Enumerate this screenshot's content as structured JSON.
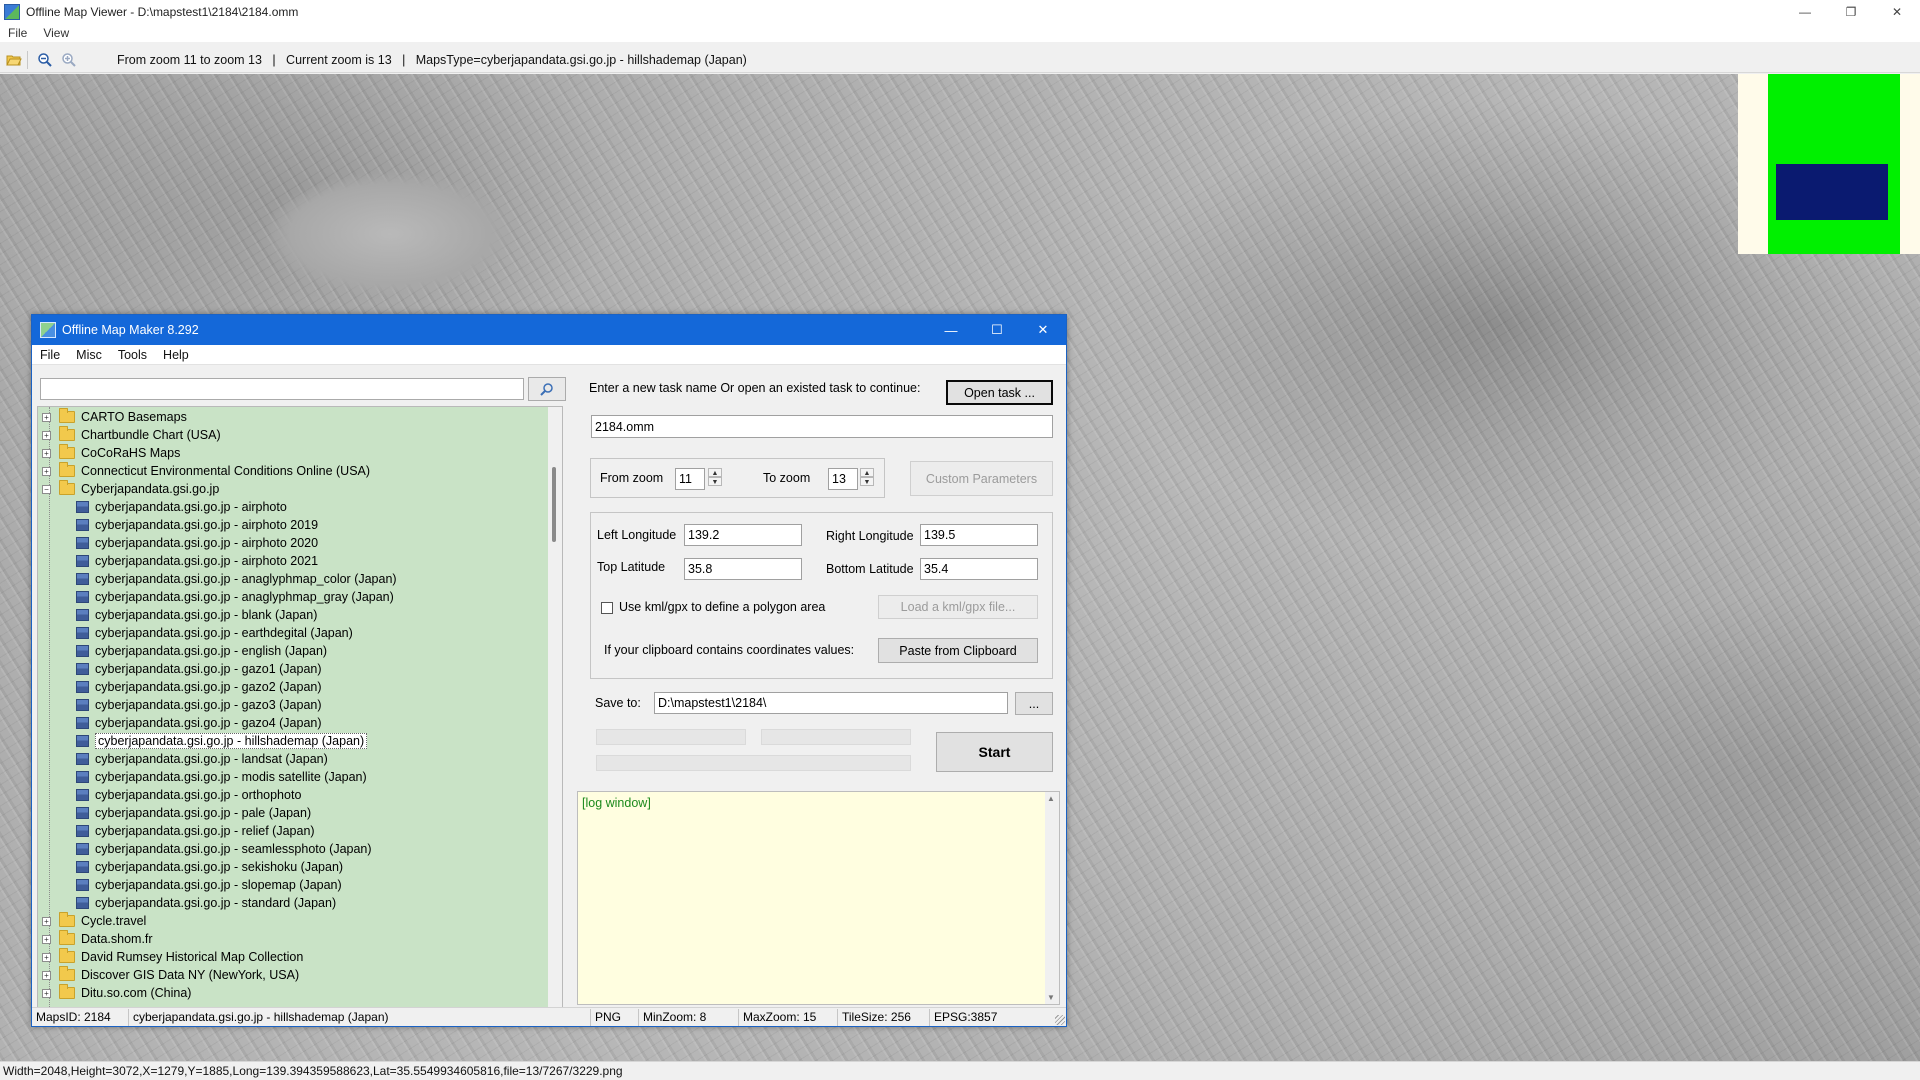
{
  "viewer": {
    "title": "Offline Map Viewer - D:\\mapstest1\\2184\\2184.omm",
    "menu": [
      "File",
      "View"
    ],
    "toolbar_info": "From zoom 11 to zoom 13   |   Current zoom is 13   |   MapsType=cyberjapandata.gsi.go.jp - hillshademap (Japan)",
    "status": "Width=2048,Height=3072,X=1279,Y=1885,Long=139.394359588623,Lat=35.5549934605816,file=13/7267/3229.png",
    "window_controls": {
      "minimize": "—",
      "maximize": "❐",
      "close": "✕"
    }
  },
  "dialog": {
    "title": "Offline Map Maker 8.292",
    "menu": [
      "File",
      "Misc",
      "Tools",
      "Help"
    ],
    "window_controls": {
      "minimize": "—",
      "maximize": "☐",
      "close": "✕"
    },
    "search": {
      "value": "",
      "placeholder": ""
    },
    "tree": {
      "top_folders": [
        {
          "label": "CARTO Basemaps",
          "expanded": false
        },
        {
          "label": "Chartbundle Chart (USA)",
          "expanded": false
        },
        {
          "label": "CoCoRaHS Maps",
          "expanded": false
        },
        {
          "label": "Connecticut Environmental Conditions Online (USA)",
          "expanded": false
        },
        {
          "label": "Cyberjapandata.gsi.go.jp",
          "expanded": true
        }
      ],
      "children": [
        "cyberjapandata.gsi.go.jp - airphoto",
        "cyberjapandata.gsi.go.jp - airphoto 2019",
        "cyberjapandata.gsi.go.jp - airphoto 2020",
        "cyberjapandata.gsi.go.jp - airphoto 2021",
        "cyberjapandata.gsi.go.jp - anaglyphmap_color (Japan)",
        "cyberjapandata.gsi.go.jp - anaglyphmap_gray (Japan)",
        "cyberjapandata.gsi.go.jp - blank (Japan)",
        "cyberjapandata.gsi.go.jp - earthdegital (Japan)",
        "cyberjapandata.gsi.go.jp - english (Japan)",
        "cyberjapandata.gsi.go.jp - gazo1 (Japan)",
        "cyberjapandata.gsi.go.jp - gazo2 (Japan)",
        "cyberjapandata.gsi.go.jp - gazo3 (Japan)",
        "cyberjapandata.gsi.go.jp - gazo4 (Japan)",
        "cyberjapandata.gsi.go.jp - hillshademap (Japan)",
        "cyberjapandata.gsi.go.jp - landsat (Japan)",
        "cyberjapandata.gsi.go.jp - modis satellite (Japan)",
        "cyberjapandata.gsi.go.jp - orthophoto",
        "cyberjapandata.gsi.go.jp - pale (Japan)",
        "cyberjapandata.gsi.go.jp - relief (Japan)",
        "cyberjapandata.gsi.go.jp - seamlessphoto (Japan)",
        "cyberjapandata.gsi.go.jp - sekishoku (Japan)",
        "cyberjapandata.gsi.go.jp - slopemap (Japan)",
        "cyberjapandata.gsi.go.jp - standard (Japan)"
      ],
      "selected_child": "cyberjapandata.gsi.go.jp - hillshademap (Japan)",
      "bottom_folders": [
        "Cycle.travel",
        "Data.shom.fr",
        "David Rumsey Historical Map Collection",
        "Discover GIS Data NY (NewYork, USA)",
        "Ditu.so.com (China)"
      ]
    },
    "form": {
      "task_prompt": "Enter a new task name Or open an existed task to continue:",
      "open_task_label": "Open task ...",
      "task_name": "2184.omm",
      "from_zoom_label": "From zoom",
      "from_zoom": "11",
      "to_zoom_label": "To zoom",
      "to_zoom": "13",
      "custom_params_label": "Custom Parameters",
      "left_lon_label": "Left Longitude",
      "left_lon": "139.2",
      "right_lon_label": "Right Longitude",
      "right_lon": "139.5",
      "top_lat_label": "Top Latitude",
      "top_lat": "35.8",
      "bottom_lat_label": "Bottom Latitude",
      "bottom_lat": "35.4",
      "kml_label": "Use kml/gpx to define a polygon area",
      "load_kml_label": "Load a kml/gpx file...",
      "clipboard_prompt": "If your clipboard contains coordinates values:",
      "paste_label": "Paste from Clipboard",
      "save_to_label": "Save to:",
      "save_to": "D:\\mapstest1\\2184\\",
      "browse_label": "...",
      "start_label": "Start"
    },
    "log": {
      "text": "[log window]"
    },
    "status": {
      "maps_id": "MapsID: 2184",
      "maps_name": "cyberjapandata.gsi.go.jp - hillshademap (Japan)",
      "format": "PNG",
      "min_zoom": "MinZoom: 8",
      "max_zoom": "MaxZoom: 15",
      "tile_size": "TileSize: 256",
      "epsg": "EPSG:3857"
    }
  }
}
